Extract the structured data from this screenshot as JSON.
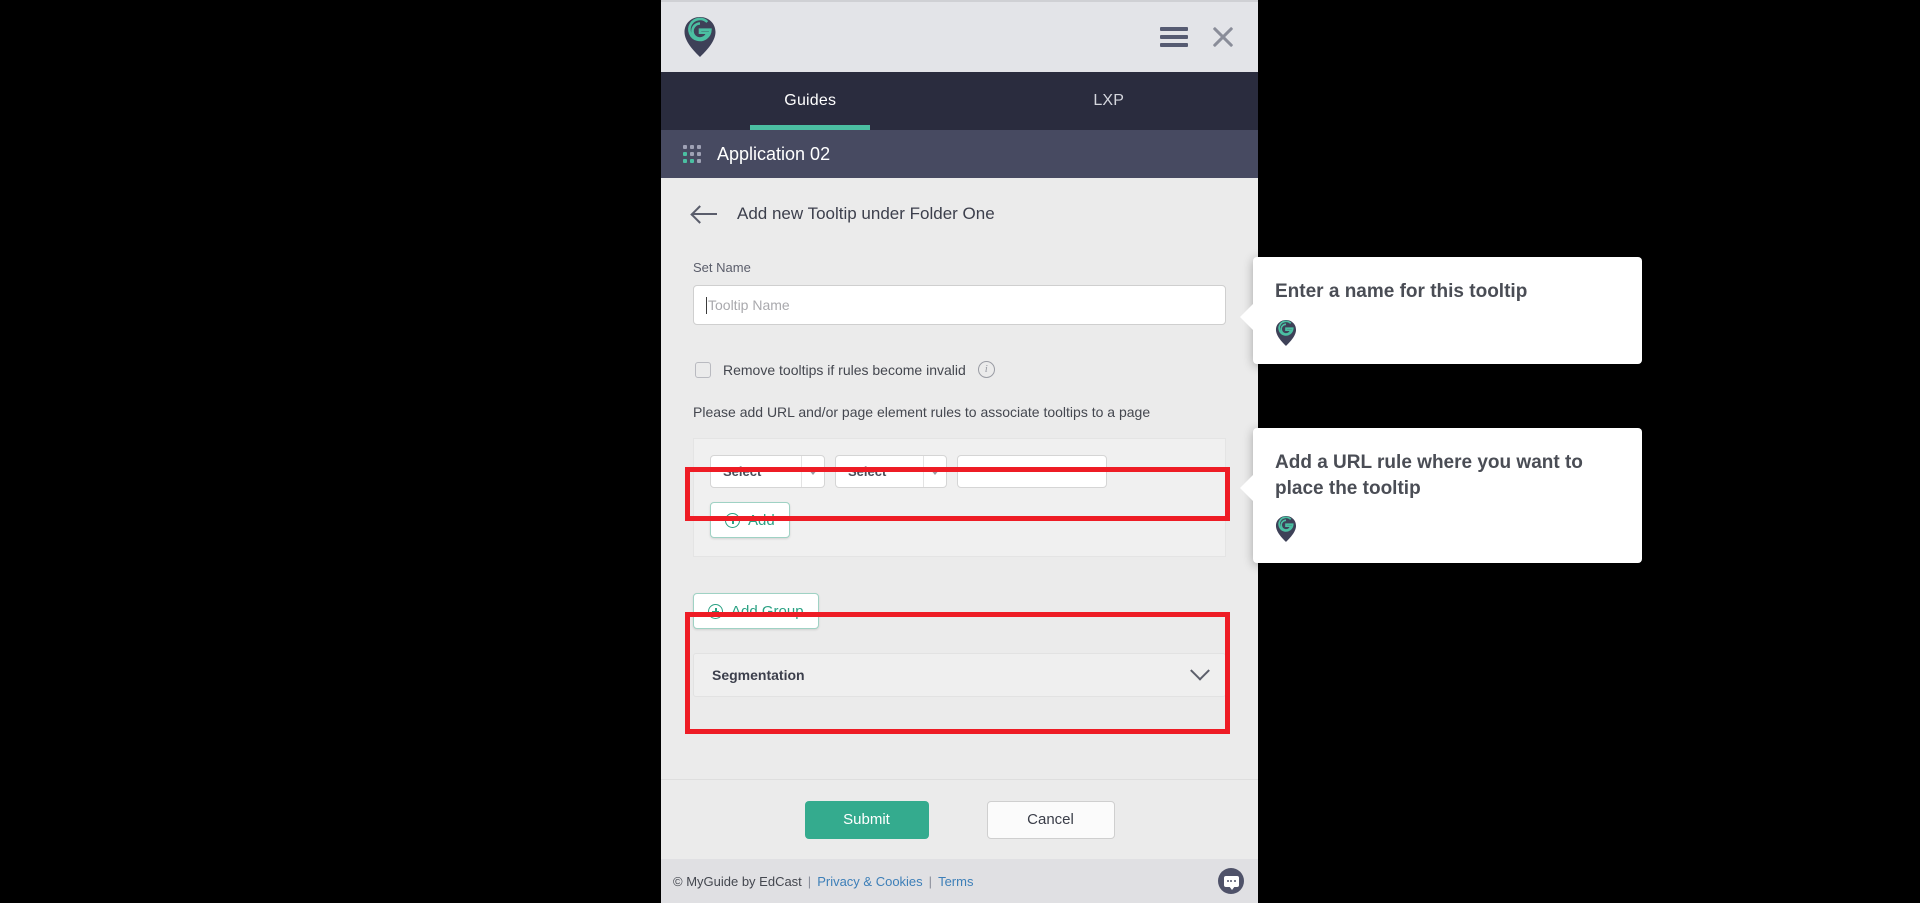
{
  "brand": {
    "logo_icon": "map-pin-g-logo",
    "accent_color": "#4bbfa2",
    "dark_color": "#2a2c3e",
    "highlight_color": "#ee1c25"
  },
  "header": {
    "menu_icon": "hamburger-menu-icon",
    "close_icon": "close-icon"
  },
  "tabs": [
    {
      "label": "Guides",
      "active": true
    },
    {
      "label": "LXP",
      "active": false
    }
  ],
  "appbar": {
    "grid_icon": "app-grid-icon",
    "title": "Application 02"
  },
  "breadcrumb": {
    "back_icon": "back-arrow-icon",
    "title": "Add new Tooltip under Folder One"
  },
  "form": {
    "name_label": "Set Name",
    "name_placeholder": "Tooltip Name",
    "name_value": "",
    "checkbox_label": "Remove tooltips if rules become invalid",
    "checkbox_checked": false,
    "info_icon": "info-icon",
    "rules_hint": "Please add URL and/or page element rules to associate tooltips to a page",
    "rule_row": {
      "select_1": "Select",
      "select_2": "Select",
      "value": ""
    },
    "add_label": "Add",
    "add_group_label": "Add Group",
    "segmentation_label": "Segmentation",
    "segmentation_chevron": "chevron-down-icon"
  },
  "actions": {
    "submit_label": "Submit",
    "cancel_label": "Cancel"
  },
  "footer": {
    "copyright": "© MyGuide by EdCast",
    "sep1": "|",
    "privacy_label": "Privacy & Cookies",
    "sep2": "|",
    "terms_label": "Terms",
    "chat_icon": "chat-bubble-icon"
  },
  "callouts": [
    {
      "text": "Enter a name for this tooltip",
      "pin_icon": "map-pin-g-logo"
    },
    {
      "text": "Add a URL rule where you want to place the tooltip",
      "pin_icon": "map-pin-g-logo"
    }
  ]
}
